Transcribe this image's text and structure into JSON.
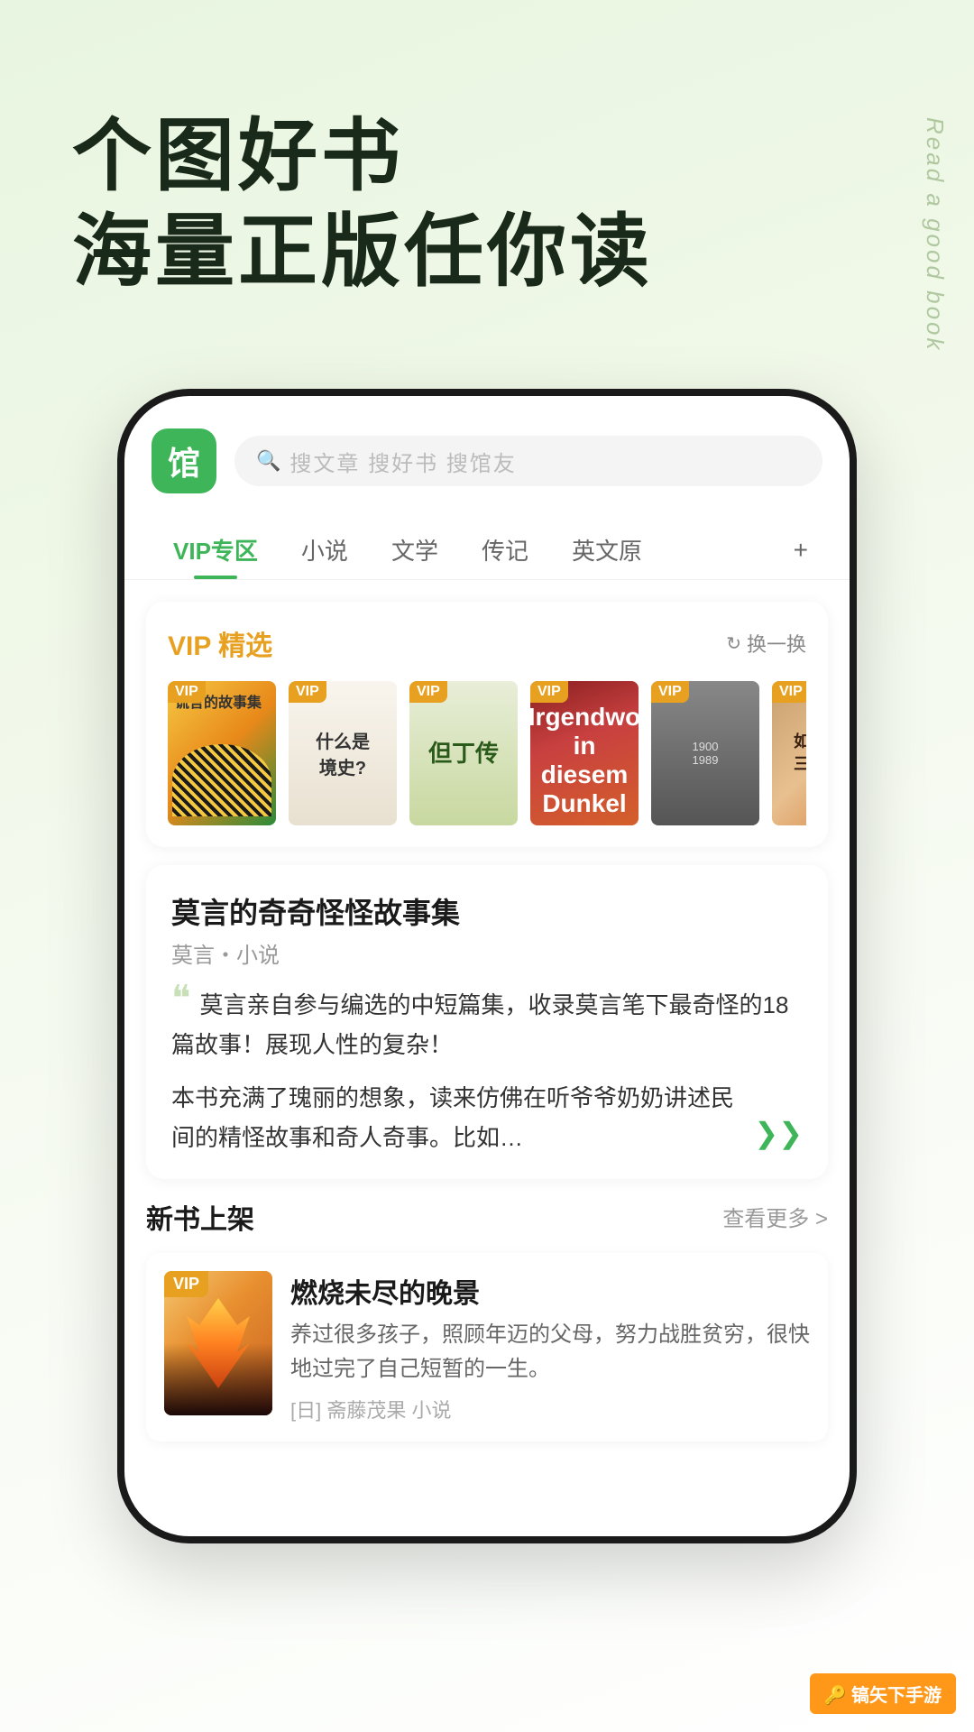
{
  "hero": {
    "line1": "个图好书",
    "line2": "海量正版任你读",
    "side_text": "Read a good book",
    "bg_gradient_start": "#e8f5e0",
    "bg_gradient_end": "#f5faf0"
  },
  "app": {
    "logo_text": "馆",
    "search_placeholder": "搜文章 搜好书 搜馆友"
  },
  "nav": {
    "tabs": [
      {
        "label": "VIP专区",
        "active": true
      },
      {
        "label": "小说",
        "active": false
      },
      {
        "label": "文学",
        "active": false
      },
      {
        "label": "传记",
        "active": false
      },
      {
        "label": "英文原",
        "active": false
      }
    ],
    "plus_label": "+"
  },
  "vip_section": {
    "title": "VIP 精选",
    "refresh_label": "换一换",
    "books": [
      {
        "vip": true,
        "title": "谎言的故事集",
        "type": "1"
      },
      {
        "vip": true,
        "title": "什么是境史?",
        "type": "2"
      },
      {
        "vip": true,
        "title": "但丁传",
        "type": "3"
      },
      {
        "vip": true,
        "title": "Irgendwo in diesem Dunkel",
        "type": "4"
      },
      {
        "vip": true,
        "title": "1900 1989",
        "type": "5"
      },
      {
        "vip": true,
        "title": "如何带着三文旅行",
        "type": "6"
      }
    ]
  },
  "featured": {
    "title": "莫言的奇奇怪怪故事集",
    "author": "莫言・小说",
    "quote_mark": "❝",
    "desc1": "莫言亲自参与编选的中短篇集，收录莫言笔下最奇怪的18篇故事！展现人性的复杂！",
    "desc2": "本书充满了瑰丽的想象，读来仿佛在听爷爷奶奶讲述民间的精怪故事和奇人奇事。比如…",
    "expand_icon": "❯❯"
  },
  "new_books": {
    "section_title": "新书上架",
    "more_label": "查看更多 >",
    "book": {
      "vip_badge": "VIP",
      "title": "燃烧未尽的晚景",
      "author_info": "[日] 斋藤茂果 小说",
      "desc": "养过很多孩子，照顾年迈的父母，努力战胜贫穷，很快地过完了自己短暂的一生。"
    }
  },
  "watermark": {
    "text": "镐矢下手游"
  }
}
